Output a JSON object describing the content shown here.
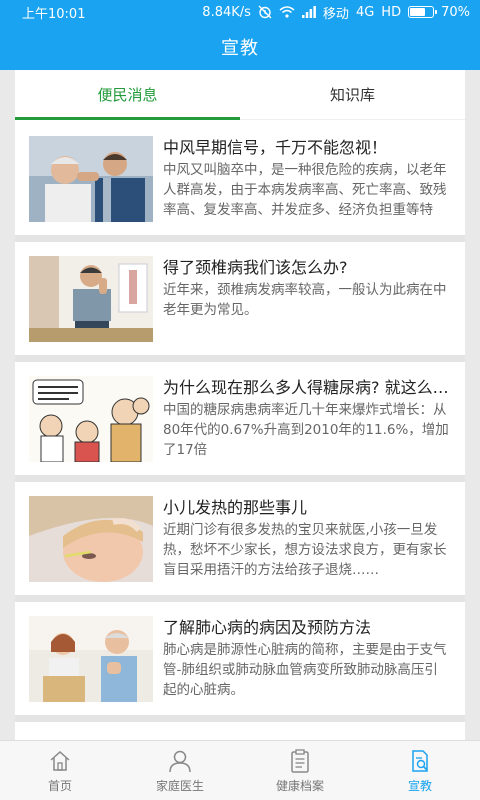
{
  "status": {
    "time": "上午10:01",
    "speed": "8.84K/s",
    "carrier": "移动",
    "network": "4G",
    "hd": "HD",
    "battery": "70%",
    "battery_level": 0.7
  },
  "header": {
    "title": "宣教"
  },
  "tabs": [
    {
      "label": "便民消息",
      "active": true
    },
    {
      "label": "知识库",
      "active": false
    }
  ],
  "articles": [
    {
      "title": "中风早期信号，千万不能忽视！",
      "desc": "中风又叫脑卒中，是一种很危险的疾病，以老年人群高发，由于本病发病率高、死亡率高、致残率高、复发率高、并发症多、经济负担重等特点……",
      "thumb": "elderly-man-headache-photo"
    },
    {
      "title": "得了颈椎病我们该怎么办?",
      "desc": "近年来，颈椎病发病率较高，一般认为此病在中老年更为常见。",
      "thumb": "man-holding-neck-photo"
    },
    {
      "title": "为什么现在那么多人得糖尿病? 就这么简单",
      "desc": "中国的糖尿病患病率近几十年来爆炸式增长：从80年代的0.67%升高到2010年的11.6%，增加了17倍",
      "thumb": "diabetes-cartoon"
    },
    {
      "title": "小儿发热的那些事儿",
      "desc": "近期门诊有很多发热的宝贝来就医,小孩一旦发热，愁坏不少家长，想方设法求良方，更有家长盲目采用捂汗的方法给孩子退烧……",
      "thumb": "child-thermometer-photo"
    },
    {
      "title": "了解肺心病的病因及预防方法",
      "desc": "肺心病是肺源性心脏病的简称，主要是由于支气管-肺组织或肺动脉血管病变所致肺动脉高压引起的心脏病。",
      "thumb": "elderly-couple-photo"
    }
  ],
  "bottom_nav": [
    {
      "label": "首页",
      "icon": "home-icon",
      "active": false
    },
    {
      "label": "家庭医生",
      "icon": "doctor-icon",
      "active": false
    },
    {
      "label": "健康档案",
      "icon": "clipboard-icon",
      "active": false
    },
    {
      "label": "宣教",
      "icon": "education-icon",
      "active": true
    }
  ],
  "colors": {
    "primary": "#1aa3f0",
    "tab_active": "#239b3a"
  }
}
